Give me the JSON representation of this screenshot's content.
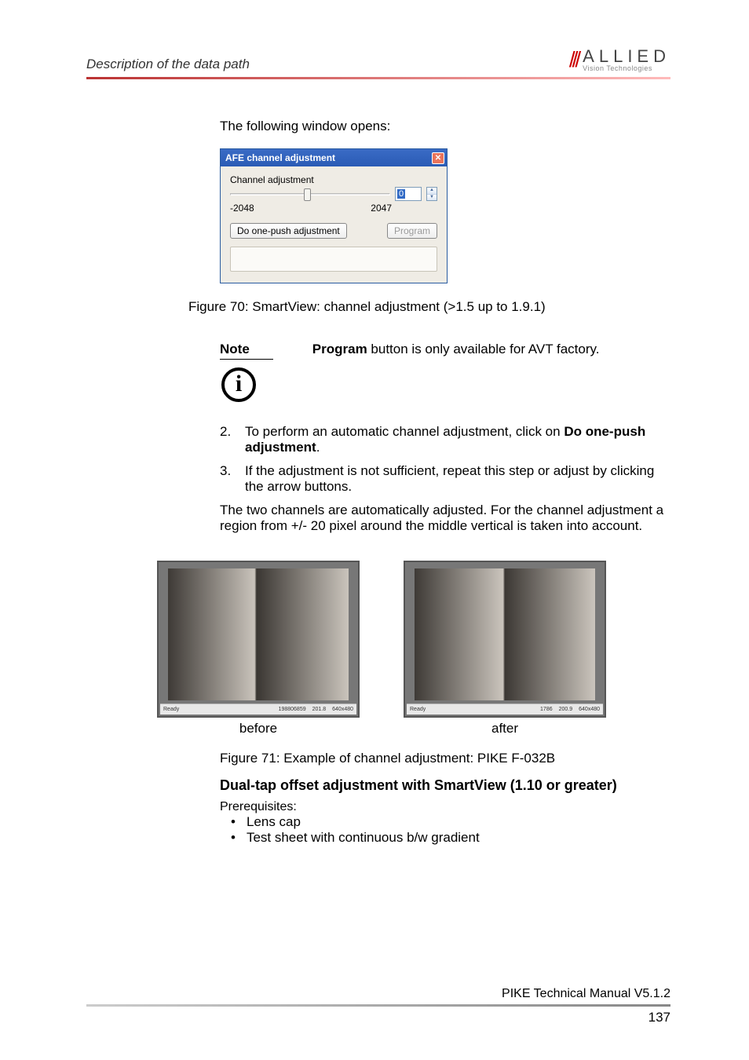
{
  "header": {
    "section": "Description of the data path"
  },
  "logo": {
    "slashes": "///",
    "main": "ALLIED",
    "sub": "Vision Technologies"
  },
  "intro": "The following window opens:",
  "dialog": {
    "title": "AFE channel adjustment",
    "label": "Channel adjustment",
    "value": "0",
    "min": "-2048",
    "max": "2047",
    "onepush": "Do one-push adjustment",
    "program": "Program"
  },
  "fig70": "Figure 70: SmartView: channel adjustment (>1.5 up to 1.9.1)",
  "note": {
    "label": "Note",
    "text_before": "Program",
    "text_after": " button is only available for AVT factory."
  },
  "steps": {
    "s2num": "2.",
    "s2": "To perform an automatic channel adjustment, click on ",
    "s2bold": "Do one-push adjustment",
    "s2end": ".",
    "s3num": "3.",
    "s3": "If the adjustment is not sufficient, repeat this step or adjust by clicking the arrow buttons."
  },
  "para": "The two channels are automatically adjusted. For the channel adjustment a region from +/- 20 pixel around the middle vertical is taken into account.",
  "images": {
    "before": "before",
    "after": "after",
    "sb_left_b": "Ready",
    "sb_r1_b": "198806859",
    "sb_r2_b": "201.8",
    "sb_r3_b": "640x480",
    "sb_left_a": "Ready",
    "sb_r1_a": "1786",
    "sb_r2_a": "200.9",
    "sb_r3_a": "640x480"
  },
  "fig71": "Figure 71: Example of channel adjustment: PIKE F-032B",
  "h3": "Dual-tap offset adjustment with SmartView (1.10 or greater)",
  "prereq": "Prerequisites:",
  "bullets": {
    "b1": "Lens cap",
    "b2": "Test sheet with continuous b/w gradient"
  },
  "footer": {
    "doc": "PIKE Technical Manual V5.1.2",
    "page": "137"
  }
}
